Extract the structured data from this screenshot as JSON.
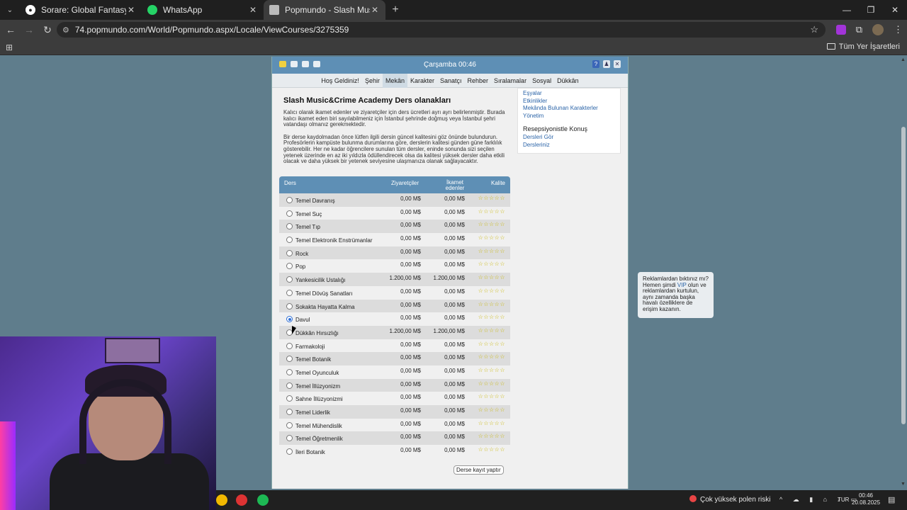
{
  "browser": {
    "tabs": [
      {
        "title": "Sorare: Global Fantasy Football",
        "active": false
      },
      {
        "title": "WhatsApp",
        "active": false
      },
      {
        "title": "Popmundo - Slash Music&Crim",
        "active": true
      }
    ],
    "url": "74.popmundo.com/World/Popmundo.aspx/Locale/ViewCourses/3275359",
    "bookmarks_label": "Tüm Yer İşaretleri"
  },
  "game": {
    "clock": "Çarşamba 00:46",
    "menu": [
      "Hoş Geldiniz!",
      "Şehir",
      "Mekân",
      "Karakter",
      "Sanatçı",
      "Rehber",
      "Sıralamalar",
      "Sosyal",
      "Dükkân"
    ],
    "menu_selected": "Mekân",
    "title": "Slash Music&Crime Academy Ders olanakları",
    "para1": "Kalıcı olarak ikamet edenler ve ziyaretçiler için ders ücretleri ayrı ayrı belirlenmiştir. Burada kalıcı ikamet eden biri sayılabilmeniz için İstanbul şehrinde doğmuş veya İstanbul şehri vatandaşı olmanız gerekmektedir.",
    "para2": "Bir derse kaydolmadan önce lütfen ilgili dersin güncel kalitesini göz önünde bulundurun. Profesörlerin kampüste bulunma durumlarına göre, derslerin kalitesi günden güne farklılık gösterebilir. Her ne kadar öğrencilere sunulan tüm dersler, eninde sonunda sizi seçilen yetenek üzerinde en az iki yıldızla ödüllendirecek olsa da kalitesi yüksek dersler daha etkili olacak ve daha yüksek bir yetenek seviyesine ulaşmanıza olanak sağlayacaktır.",
    "sidebar": {
      "links": [
        "Eşyalar",
        "Etkinlikler",
        "Mekânda Bulunan Karakterler",
        "Yönetim"
      ],
      "section_title": "Resepsiyonistle Konuş",
      "section_links": [
        "Dersleri Gör",
        "Dersleriniz"
      ]
    },
    "table": {
      "headers": {
        "course": "Ders",
        "visitors": "Ziyaretçiler",
        "residents": "İkamet edenler",
        "quality": "Kalite"
      },
      "rows": [
        {
          "name": "Temel Davranış",
          "visitors": "0,00 M$",
          "residents": "0,00 M$",
          "selected": false
        },
        {
          "name": "Temel Suç",
          "visitors": "0,00 M$",
          "residents": "0,00 M$",
          "selected": false
        },
        {
          "name": "Temel Tıp",
          "visitors": "0,00 M$",
          "residents": "0,00 M$",
          "selected": false
        },
        {
          "name": "Temel Elektronik Enstrümanlar",
          "visitors": "0,00 M$",
          "residents": "0,00 M$",
          "selected": false
        },
        {
          "name": "Rock",
          "visitors": "0,00 M$",
          "residents": "0,00 M$",
          "selected": false
        },
        {
          "name": "Pop",
          "visitors": "0,00 M$",
          "residents": "0,00 M$",
          "selected": false
        },
        {
          "name": "Yankesicilik Ustalığı",
          "visitors": "1.200,00 M$",
          "residents": "1.200,00 M$",
          "selected": false
        },
        {
          "name": "Temel Dövüş Sanatları",
          "visitors": "0,00 M$",
          "residents": "0,00 M$",
          "selected": false
        },
        {
          "name": "Sokakta Hayatta Kalma",
          "visitors": "0,00 M$",
          "residents": "0,00 M$",
          "selected": false
        },
        {
          "name": "Davul",
          "visitors": "0,00 M$",
          "residents": "0,00 M$",
          "selected": true
        },
        {
          "name": "Dükkân Hırsızlığı",
          "visitors": "1.200,00 M$",
          "residents": "1.200,00 M$",
          "selected": false
        },
        {
          "name": "Farmakoloji",
          "visitors": "0,00 M$",
          "residents": "0,00 M$",
          "selected": false
        },
        {
          "name": "Temel Botanik",
          "visitors": "0,00 M$",
          "residents": "0,00 M$",
          "selected": false
        },
        {
          "name": "Temel Oyunculuk",
          "visitors": "0,00 M$",
          "residents": "0,00 M$",
          "selected": false
        },
        {
          "name": "Temel İllüzyonizm",
          "visitors": "0,00 M$",
          "residents": "0,00 M$",
          "selected": false
        },
        {
          "name": "Sahne İllüzyonizmi",
          "visitors": "0,00 M$",
          "residents": "0,00 M$",
          "selected": false
        },
        {
          "name": "Temel Liderlik",
          "visitors": "0,00 M$",
          "residents": "0,00 M$",
          "selected": false
        },
        {
          "name": "Temel Mühendislik",
          "visitors": "0,00 M$",
          "residents": "0,00 M$",
          "selected": false
        },
        {
          "name": "Temel Öğretmenlik",
          "visitors": "0,00 M$",
          "residents": "0,00 M$",
          "selected": false
        },
        {
          "name": "İleri Botanik",
          "visitors": "0,00 M$",
          "residents": "0,00 M$",
          "selected": false
        }
      ],
      "quality_stars": 5,
      "star_color": "#c9b600"
    },
    "enroll_button": "Derse kayıt yaptır",
    "ad": {
      "text_before": "Reklamlardan bıktınız mı? Hemen şimdi ",
      "vip": "VIP",
      "text_after": " olun ve reklamlardan kurtulun, aynı zamanda başka havalı özelliklere de erişim kazanın."
    }
  },
  "taskbar": {
    "weather": "Çok yüksek polen riski",
    "lang": "TUR",
    "time": "00:46",
    "date": "20.08.2025"
  },
  "colors": {
    "accent": "#5e8fb5",
    "link": "#2b64a8"
  }
}
